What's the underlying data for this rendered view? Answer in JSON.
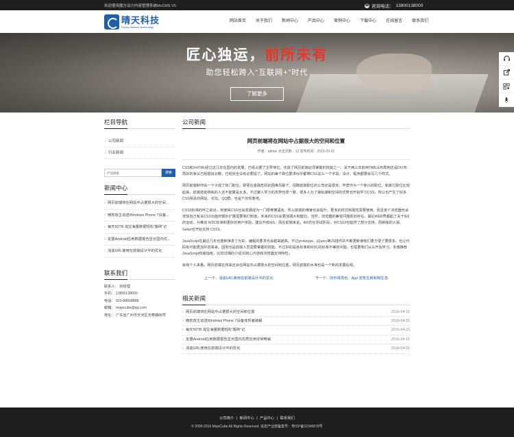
{
  "topbar": {
    "welcome": "欢迎使用魔方动力内容管理系统McCMS V5",
    "phone_label": "咨询电话：",
    "phone": "13800138000"
  },
  "logo": {
    "cn": "晴天科技",
    "en": "Sunny network technology"
  },
  "nav": [
    "网站首页",
    "关于我们",
    "新闻中心",
    "产品中心",
    "案例中心",
    "下载中心",
    "在线留言",
    "联系我们"
  ],
  "banner": {
    "title_white": "匠心独运，",
    "title_red": "前所未有",
    "subtitle": "助您轻松跨入“互联网+”时代",
    "button": "了解更多"
  },
  "side_tools": [
    "headset-icon",
    "share-icon",
    "qrcode-icon",
    "rocket-icon"
  ],
  "left": {
    "nav_title": "栏目导航",
    "nav_items": [
      "公司新闻",
      "行业新闻"
    ],
    "search_placeholder": "产品搜索",
    "search_button": "搜索",
    "news_title": "新闻中心",
    "news_items": [
      "网页前端将在网站中占据很大的空间...",
      "微软放主动送Windows Phone 7设备...",
      "每天50TB 淘宝海量数据轻松“搬砖”记",
      "友盟Android应用数据报告显示国内优...",
      "浅谈URL使用在前端设计中的优化"
    ],
    "contact_title": "联系我们",
    "contacts": [
      "联系人：  张经理",
      "手机：  13800138000",
      "电话：  020-88668888",
      "邮箱：  mojocube@qq.com",
      "地址：  广东省广州市天河区天寿路88号"
    ]
  },
  "main": {
    "section_title": "公司新闻",
    "article_title": "网页前端将在网站中占据很大的空间和位置",
    "meta": "作者：admin   点击次数：12   发布时间：2015-03-01",
    "paragraphs": [
      "CSS和XHTML经过这几年在国内的发展，已经占据了主导地位。也成了网页前端必须掌握的技能之一。关于两三年前用TABLE布局到还是DIV布局好的争议已经烟消云散，已经完全没有必要提了。网站的每个职位要求似乎都带CSS这么一个字段，设计、程序都要会写几个样式。",
      "网页前端制作由一下子成了热门职位，即便在金融危机的困难风暴下，招聘前端职位的公司还是很多。毕竟作为一个新兴的职位，和其它职位比较起来，前端技能熟练的人还不能算是太多。不过聚人学习的态势也很一致，很多人为了接轨潮和空间的优势也开始学习CSS，所以也产生了好多CSS相关的网站、论坛、QQ群。也是个好现象吧。",
      "CSS3标准的呼之欲出，将使得CSS也会发展成为一门很难懂语言。所以前端的难度也会提升。更多的样式和属性需要使用。而且各个浏览器也会增加自己有关CSS功能的额外扩展需要我们知道。未来的CSS会更加强大和健壮。当然，浏览器的兼容问题依旧存在。最近WEB界都起了关于IE6的运动，为推动 W3C标准和更好的用户体验，建议升级IE6。而在前端来说，IE6仍在测试阶段，对CSS3也提供了部分支持。而新版的火狐、Safari也开始支持 CSS3。",
      "JavaScript在最近几年也重新焕发了光彩，编程的要求也会越来越高。不过prototype、jQuery等JS插件的不断更新使我们更方便了要很多。也让代码有可能更加井容易来。因而也是前端人员需要掌握的技能。不过好的是各标准和W3C的标准不兼容问题，也需要我们从头开始学习。本博推荐JavaScript权威指南，比较详细的介绍JS核心内容和浏览器支持特性。",
      "就我个人来看，网页前端在将来还会在网站中占据很大的空间和位置。网页前端的水准也是一个新的发展后规。"
    ],
    "prev_label": "上一个：",
    "prev_link": "浅谈URL使用在前端设计中的优化",
    "next_label": "下一个：",
    "next_link": "旧市将周也、App 流变生鲜和物生态",
    "related_title": "相关新闻",
    "related": [
      {
        "title": "网页前端将在网站中占据很大的空间和位置",
        "date": "2016-04-15"
      },
      {
        "title": "微软放主动送Windows Phone 7设备体现者破解",
        "date": "2016-04-15"
      },
      {
        "title": "每天50TB 淘宝海量数据轻松“搬砖”记",
        "date": "2016-04-15"
      },
      {
        "title": "友盟Android应用数据报告显示国内优质应用非常畅销",
        "date": "2016-04-15"
      },
      {
        "title": "浅谈URL使用在前端设计中的优化",
        "date": "2016-04-15"
      }
    ]
  },
  "footer": {
    "links": [
      "公司简介",
      "新闻中心",
      "产品中心",
      "联系我们"
    ],
    "copyright": "© 2000-2016 MojoCube All Rights Reserved. 信息产业部备案号：粤ICP备12345678号"
  }
}
